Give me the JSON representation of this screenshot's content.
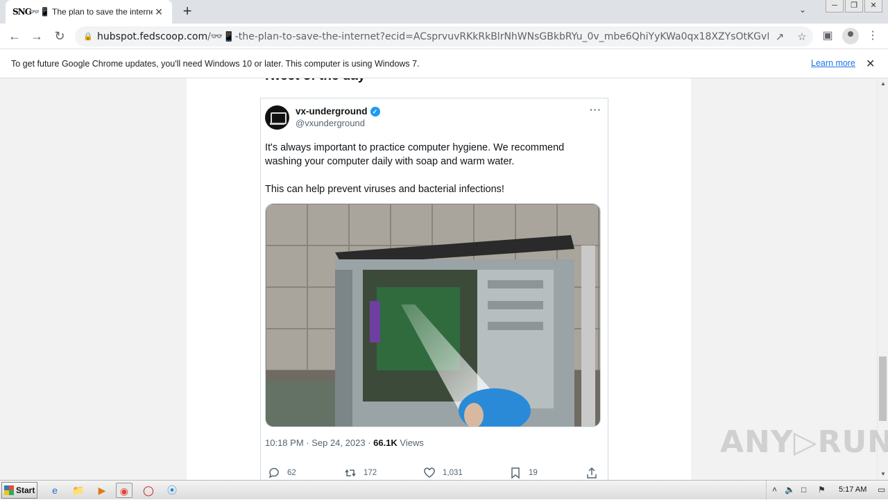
{
  "browser": {
    "tab": {
      "favicon_text": "SNG",
      "title": "👓📱 The plan to save the internet",
      "close": "✕"
    },
    "new_tab": "+",
    "tab_dropdown": "⌄",
    "window_buttons": [
      "─",
      "❐",
      "✕"
    ],
    "url_host": "hubspot.fedscoop.com",
    "url_path": "/👓📱-the-plan-to-save-the-internet?ecid=ACsprvuvRKkRkBlrNhWNsGBkbRYu_0v_mbe6QhiYyKWa0qx18XZYsOtKGvNxEoawRdsW...",
    "icons": {
      "back": "←",
      "forward": "→",
      "reload": "↻",
      "share": "↗",
      "star": "☆",
      "sidepanel": "▣",
      "menu": "⋮"
    }
  },
  "infobar": {
    "message": "To get future Google Chrome updates, you'll need Windows 10 or later. This computer is using Windows 7.",
    "learn_more": "Learn more",
    "close": "✕"
  },
  "article": {
    "section_heading": "Tweet of the day"
  },
  "tweet": {
    "name": "vx-underground",
    "handle": "@vxunderground",
    "more": "···",
    "text": [
      "It's always important to practice computer hygiene. We recommend washing your computer daily with soap and warm water.",
      "This can help prevent viruses and bacterial infections!"
    ],
    "time": "10:18 PM · Sep 24, 2023 · ",
    "views_count": "66.1K",
    "views_label": " Views",
    "replies": "62",
    "retweets": "172",
    "likes": "1,031",
    "bookmarks": "19"
  },
  "watermark": "ANY▷RUN",
  "taskbar": {
    "start": "Start",
    "clock": "5:17 AM"
  }
}
